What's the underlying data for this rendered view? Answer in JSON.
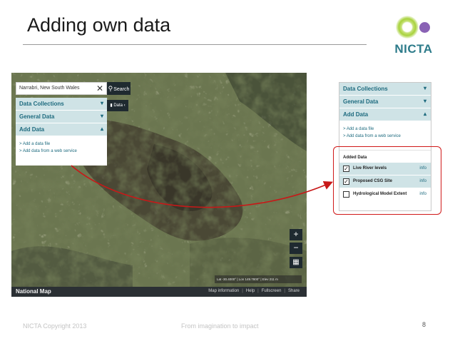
{
  "slide": {
    "title": "Adding own data",
    "logo_text": "NICTA",
    "copyright": "NICTA Copyright 2013",
    "tagline": "From imagination to impact",
    "page_number": "8"
  },
  "map": {
    "search": {
      "value": "Narrabri, New South Wales",
      "clear_glyph": "✕",
      "button_label": "Search",
      "button_icon": "search-icon"
    },
    "data_toggle_label": "Data",
    "panel": {
      "sections": [
        {
          "label": "Data Collections",
          "state": "collapsed"
        },
        {
          "label": "General Data",
          "state": "collapsed"
        },
        {
          "label": "Add Data",
          "state": "expanded"
        }
      ],
      "links": [
        "> Add a data file",
        "> Add data from a web service"
      ]
    },
    "zoom_in": "+",
    "zoom_out": "−",
    "scale_text": "Lat -30.4000° | Lon 149.7800° | Elev 211 m",
    "footer": {
      "title": "National Map",
      "links": [
        "Map information",
        "Help",
        "Fullscreen",
        "Share"
      ]
    }
  },
  "zoom_panel": {
    "sections": [
      {
        "label": "Data Collections",
        "state": "collapsed"
      },
      {
        "label": "General Data",
        "state": "collapsed"
      },
      {
        "label": "Add Data",
        "state": "expanded"
      }
    ],
    "links": [
      "> Add a data file",
      "> Add data from a web service"
    ],
    "added_heading": "Added Data",
    "added_items": [
      {
        "name": "Live River levels",
        "checked": true,
        "info": "info"
      },
      {
        "name": "Proposed CSG Site",
        "checked": true,
        "info": "info"
      },
      {
        "name": "Hydrological Model Extent",
        "checked": false,
        "info": "info"
      }
    ]
  },
  "colors": {
    "highlight": "#d01818",
    "accent": "#1e6b7f",
    "panel_row": "#cfe3e6"
  }
}
